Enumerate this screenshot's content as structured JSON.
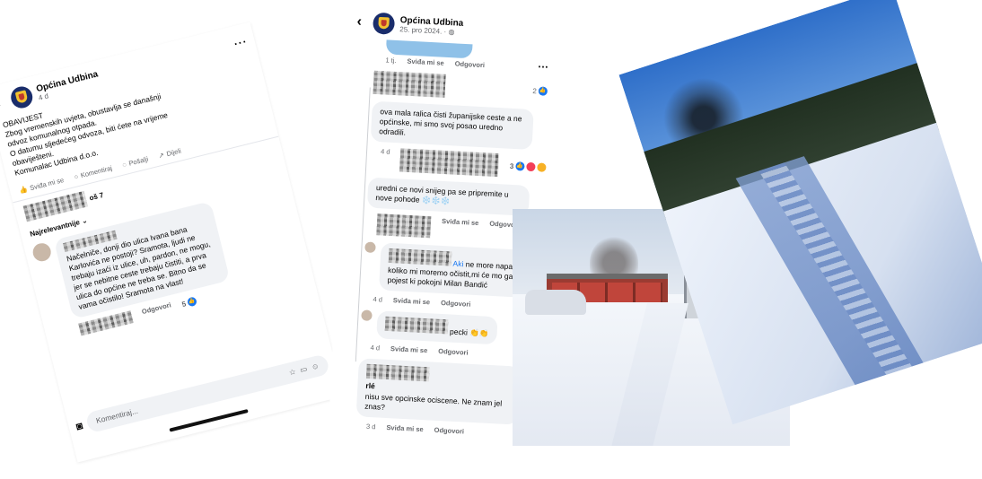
{
  "left_post": {
    "page_name": "Općina Udbina",
    "meta": "4 d",
    "body_lines": [
      "OBAVIJEST",
      "Zbog vremenskih uvjeta, obustavlja se današnji",
      "odvoz komunalnog otpada.",
      "O datumu sljedećeg odvoza, biti ćete na vrijeme",
      "obaviješteni.",
      "Komunalac Udbina d.o.o."
    ],
    "actions": {
      "like": "Sviđa mi se",
      "comment": "Komentiraj",
      "send": "Pošalji",
      "share": "Dijeli"
    },
    "reactions_count_suffix": "oš 7",
    "sort_label": "Najrelevantnije",
    "comment": {
      "text": "Načelniče, donji dio ulica Ivana bana Karlovića ne postoji? Sramota, ljudi ne trebaju izaći iz ulice, uh, pardon, ne mogu, jer se nebitne ceste trebaju čistiti, a prva ulica do općine ne treba se. Bitno da se vama očistilo! Sramota na vlast!",
      "reply": "Odgovori",
      "likes": "5"
    },
    "composer_placeholder": "Komentiraj..."
  },
  "mid_post": {
    "page_name": "Općina Udbina",
    "date": "25. pro 2024. · ",
    "comments": [
      {
        "age": "1 tj.",
        "like": "Sviđa mi se",
        "reply": "Odgovori",
        "likes": "2"
      },
      {
        "mention": "",
        "text": "ova mala ralica čisti županijske ceste a ne općinske, mi smo svoj posao uredno odradili.",
        "age": "4 d",
        "like": "",
        "reply": "",
        "likes": "3"
      },
      {
        "text": "uredni ce novi snijeg pa se pripremite u nove pohode ❄️❄️❄️",
        "age": "4 d",
        "like": "Sviđa mi se",
        "reply": "Odgovori"
      },
      {
        "mention": "A",
        "mention_tail": "ki",
        "text": "ne more napadat koliko mi moremo očistit,mi će mo ga pojest ki pokojni Milan Bandić",
        "age": "4 d",
        "like": "Sviđa mi se",
        "reply": "Odgovori"
      },
      {
        "text": "pecki 👏👏",
        "age": "4 d",
        "like": "Sviđa mi se",
        "reply": "Odgovori"
      },
      {
        "name_tail": "rlé",
        "text": "nisu sve opcinske ociscene. Ne znam jel znas?",
        "age": "3 d",
        "like": "Sviđa mi se",
        "reply": "Odgovori"
      }
    ]
  },
  "colors": {
    "link": "#1877f2",
    "muted": "#65676b",
    "bubble": "#f0f2f5"
  }
}
